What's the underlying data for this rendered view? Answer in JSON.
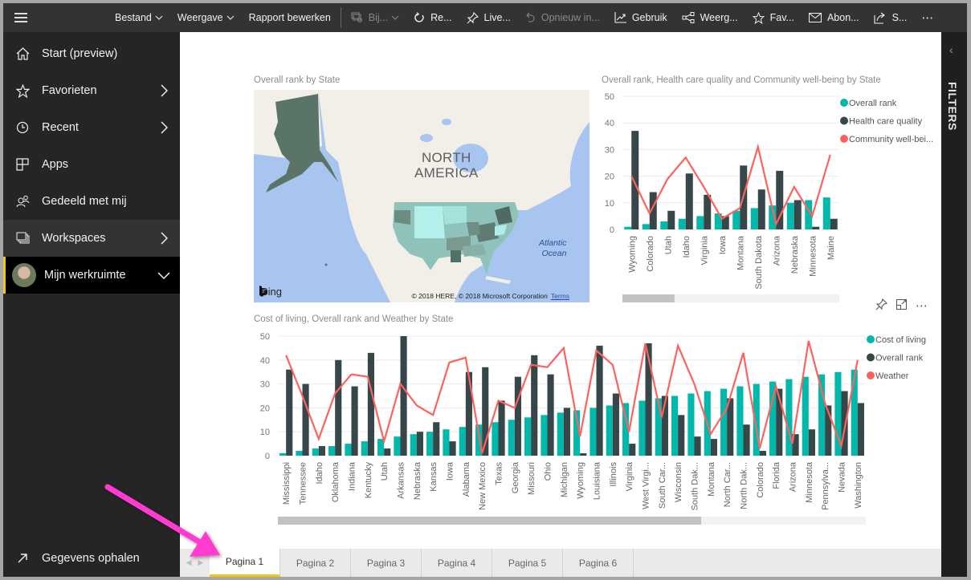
{
  "toolbar": {
    "items": [
      {
        "label": "Bestand",
        "icon": "",
        "dropdown": true,
        "disabled": false
      },
      {
        "label": "Weergave",
        "icon": "",
        "dropdown": true,
        "disabled": false
      },
      {
        "label": "Rapport bewerken",
        "icon": "",
        "dropdown": false,
        "disabled": false
      },
      {
        "label": "Bij...",
        "icon": "explore-icon",
        "dropdown": true,
        "disabled": true
      },
      {
        "label": "Re...",
        "icon": "refresh-icon",
        "dropdown": false,
        "disabled": false
      },
      {
        "label": "Live...",
        "icon": "pin-icon",
        "dropdown": false,
        "disabled": false
      },
      {
        "label": "Opnieuw in...",
        "icon": "undo-icon",
        "dropdown": false,
        "disabled": true
      },
      {
        "label": "Gebruik",
        "icon": "usage-metrics-icon",
        "dropdown": false,
        "disabled": false
      },
      {
        "label": "Weerg...",
        "icon": "related-content-icon",
        "dropdown": false,
        "disabled": false
      },
      {
        "label": "Fav...",
        "icon": "star-icon",
        "dropdown": false,
        "disabled": false
      },
      {
        "label": "Abon...",
        "icon": "mail-icon",
        "dropdown": false,
        "disabled": false
      },
      {
        "label": "S...",
        "icon": "share-icon",
        "dropdown": false,
        "disabled": false
      }
    ],
    "more": "⋯"
  },
  "sidebar": {
    "items": [
      {
        "label": "Start (preview)",
        "icon": "home-icon",
        "arrow": ""
      },
      {
        "label": "Favorieten",
        "icon": "star-icon",
        "arrow": "›"
      },
      {
        "label": "Recent",
        "icon": "clock-icon",
        "arrow": "›"
      },
      {
        "label": "Apps",
        "icon": "apps-icon",
        "arrow": ""
      },
      {
        "label": "Gedeeld met mij",
        "icon": "shared-icon",
        "arrow": ""
      },
      {
        "label": "Workspaces",
        "icon": "workspaces-icon",
        "arrow": "›"
      },
      {
        "label": "Mijn werkruimte",
        "icon": "avatar",
        "arrow": "∨"
      }
    ],
    "bottom": {
      "label": "Gegevens ophalen",
      "icon": "get-data-icon"
    }
  },
  "filters": {
    "label": "FILTERS"
  },
  "map": {
    "title": "Overall rank by State",
    "region_label": [
      "NORTH",
      "AMERICA"
    ],
    "ocean_label": [
      "Atlantic",
      "Ocean"
    ],
    "provider": "Bing",
    "copyright": "© 2018 HERE, © 2018 Microsoft Corporation",
    "terms": "Terms"
  },
  "colors": {
    "teal": "#01b8aa",
    "dark": "#374649",
    "red": "#fd625e",
    "accent": "#f2c811"
  },
  "chart_data": [
    {
      "type": "bar",
      "title": "Overall rank, Health care quality and Community well-being by State",
      "categories": [
        "Wyoming",
        "Colorado",
        "Utah",
        "Idaho",
        "Virginia",
        "Iowa",
        "Montana",
        "South Dakota",
        "Arizona",
        "Nebraska",
        "Minnesota",
        "Maine"
      ],
      "series": [
        {
          "name": "Overall rank",
          "kind": "bar",
          "values": [
            1,
            2,
            3,
            4,
            5,
            6,
            7,
            8,
            9,
            10,
            11,
            12
          ]
        },
        {
          "name": "Health care quality",
          "kind": "bar",
          "values": [
            37,
            14,
            7,
            21,
            13,
            5,
            24,
            15,
            22,
            11,
            1,
            4
          ]
        },
        {
          "name": "Community well-bei...",
          "kind": "line",
          "values": [
            20,
            6,
            19,
            27,
            16,
            4,
            8,
            31,
            2,
            16,
            5,
            28
          ]
        }
      ],
      "yticks": [
        0,
        10,
        20,
        30,
        40,
        50
      ],
      "ylim": [
        0,
        50
      ],
      "legend": "right",
      "grid": true,
      "scroll_fraction": 0.24
    },
    {
      "type": "bar",
      "title": "Cost of living, Overall rank and Weather by State",
      "categories": [
        "Mississippi",
        "Tennessee",
        "Idaho",
        "Oklahoma",
        "Indiana",
        "Kentucky",
        "Utah",
        "Arkansas",
        "Nebraska",
        "Kansas",
        "Iowa",
        "Alabama",
        "New Mexico",
        "Texas",
        "Georgia",
        "Missouri",
        "Ohio",
        "Michigan",
        "Wyoming",
        "Louisiana",
        "Illinois",
        "Virginia",
        "West Virgi...",
        "South Car...",
        "Wisconsin",
        "South Dak...",
        "Montana",
        "North Car...",
        "North Dak...",
        "Colorado",
        "Florida",
        "Arizona",
        "Minnesota",
        "Pennsylva...",
        "Nevada",
        "Washington"
      ],
      "series": [
        {
          "name": "Cost of living",
          "kind": "bar",
          "values": [
            1,
            2,
            3,
            4,
            5,
            6,
            7,
            8,
            9,
            10,
            11,
            12,
            13,
            14,
            15,
            16,
            17,
            18,
            19,
            20,
            21,
            22,
            23,
            24,
            25,
            26,
            27,
            28,
            29,
            30,
            31,
            32,
            33,
            34,
            35,
            36
          ]
        },
        {
          "name": "Overall rank",
          "kind": "bar",
          "values": [
            36,
            30,
            4,
            40,
            29,
            43,
            3,
            50,
            10,
            14,
            6,
            35,
            37,
            23,
            33,
            42,
            34,
            20,
            1,
            46,
            26,
            5,
            47,
            25,
            17,
            8,
            7,
            24,
            13,
            2,
            28,
            9,
            11,
            21,
            27,
            22
          ]
        },
        {
          "name": "Weather",
          "kind": "line",
          "values": [
            42,
            25,
            7,
            26,
            34,
            33,
            6,
            30,
            21,
            17,
            39,
            41,
            1,
            23,
            20,
            38,
            37,
            45,
            8,
            44,
            38,
            10,
            47,
            16,
            46,
            30,
            9,
            20,
            43,
            3,
            29,
            5,
            48,
            22,
            4,
            40
          ]
        }
      ],
      "yticks": [
        0,
        10,
        20,
        30,
        40,
        50
      ],
      "ylim": [
        0,
        50
      ],
      "legend": "right",
      "grid": true,
      "scroll_fraction": 0.72
    }
  ],
  "visual_actions": {
    "pin": "pin-icon",
    "focus": "focus-mode-icon",
    "more": "⋯"
  },
  "pages": {
    "tabs": [
      "Pagina 1",
      "Pagina 2",
      "Pagina 3",
      "Pagina 4",
      "Pagina 5",
      "Pagina 6"
    ],
    "active": 0
  }
}
